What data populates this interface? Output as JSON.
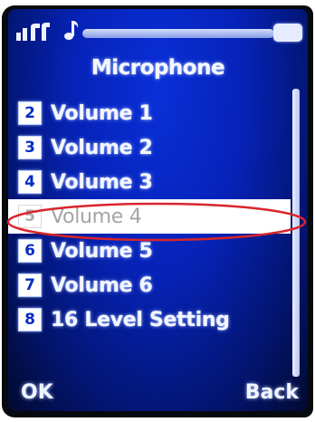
{
  "screen": {
    "title": "Microphone",
    "status_icons": [
      "signal-icon",
      "music-icon",
      "battery-icon"
    ],
    "menu_items": [
      {
        "number": "2",
        "label": "Volume 1",
        "selected": false
      },
      {
        "number": "3",
        "label": "Volume 2",
        "selected": false
      },
      {
        "number": "4",
        "label": "Volume 3",
        "selected": false
      },
      {
        "number": "5",
        "label": "Volume 4",
        "selected": true
      },
      {
        "number": "6",
        "label": "Volume 5",
        "selected": false
      },
      {
        "number": "7",
        "label": "Volume 6",
        "selected": false
      },
      {
        "number": "8",
        "label": "16 Level Setting",
        "selected": false
      }
    ],
    "softkeys": {
      "left": "OK",
      "right": "Back"
    }
  },
  "colors": {
    "screen_background": "#0623b8",
    "selection_background": "#ffffff",
    "annotation_ellipse": "#d9252a"
  }
}
